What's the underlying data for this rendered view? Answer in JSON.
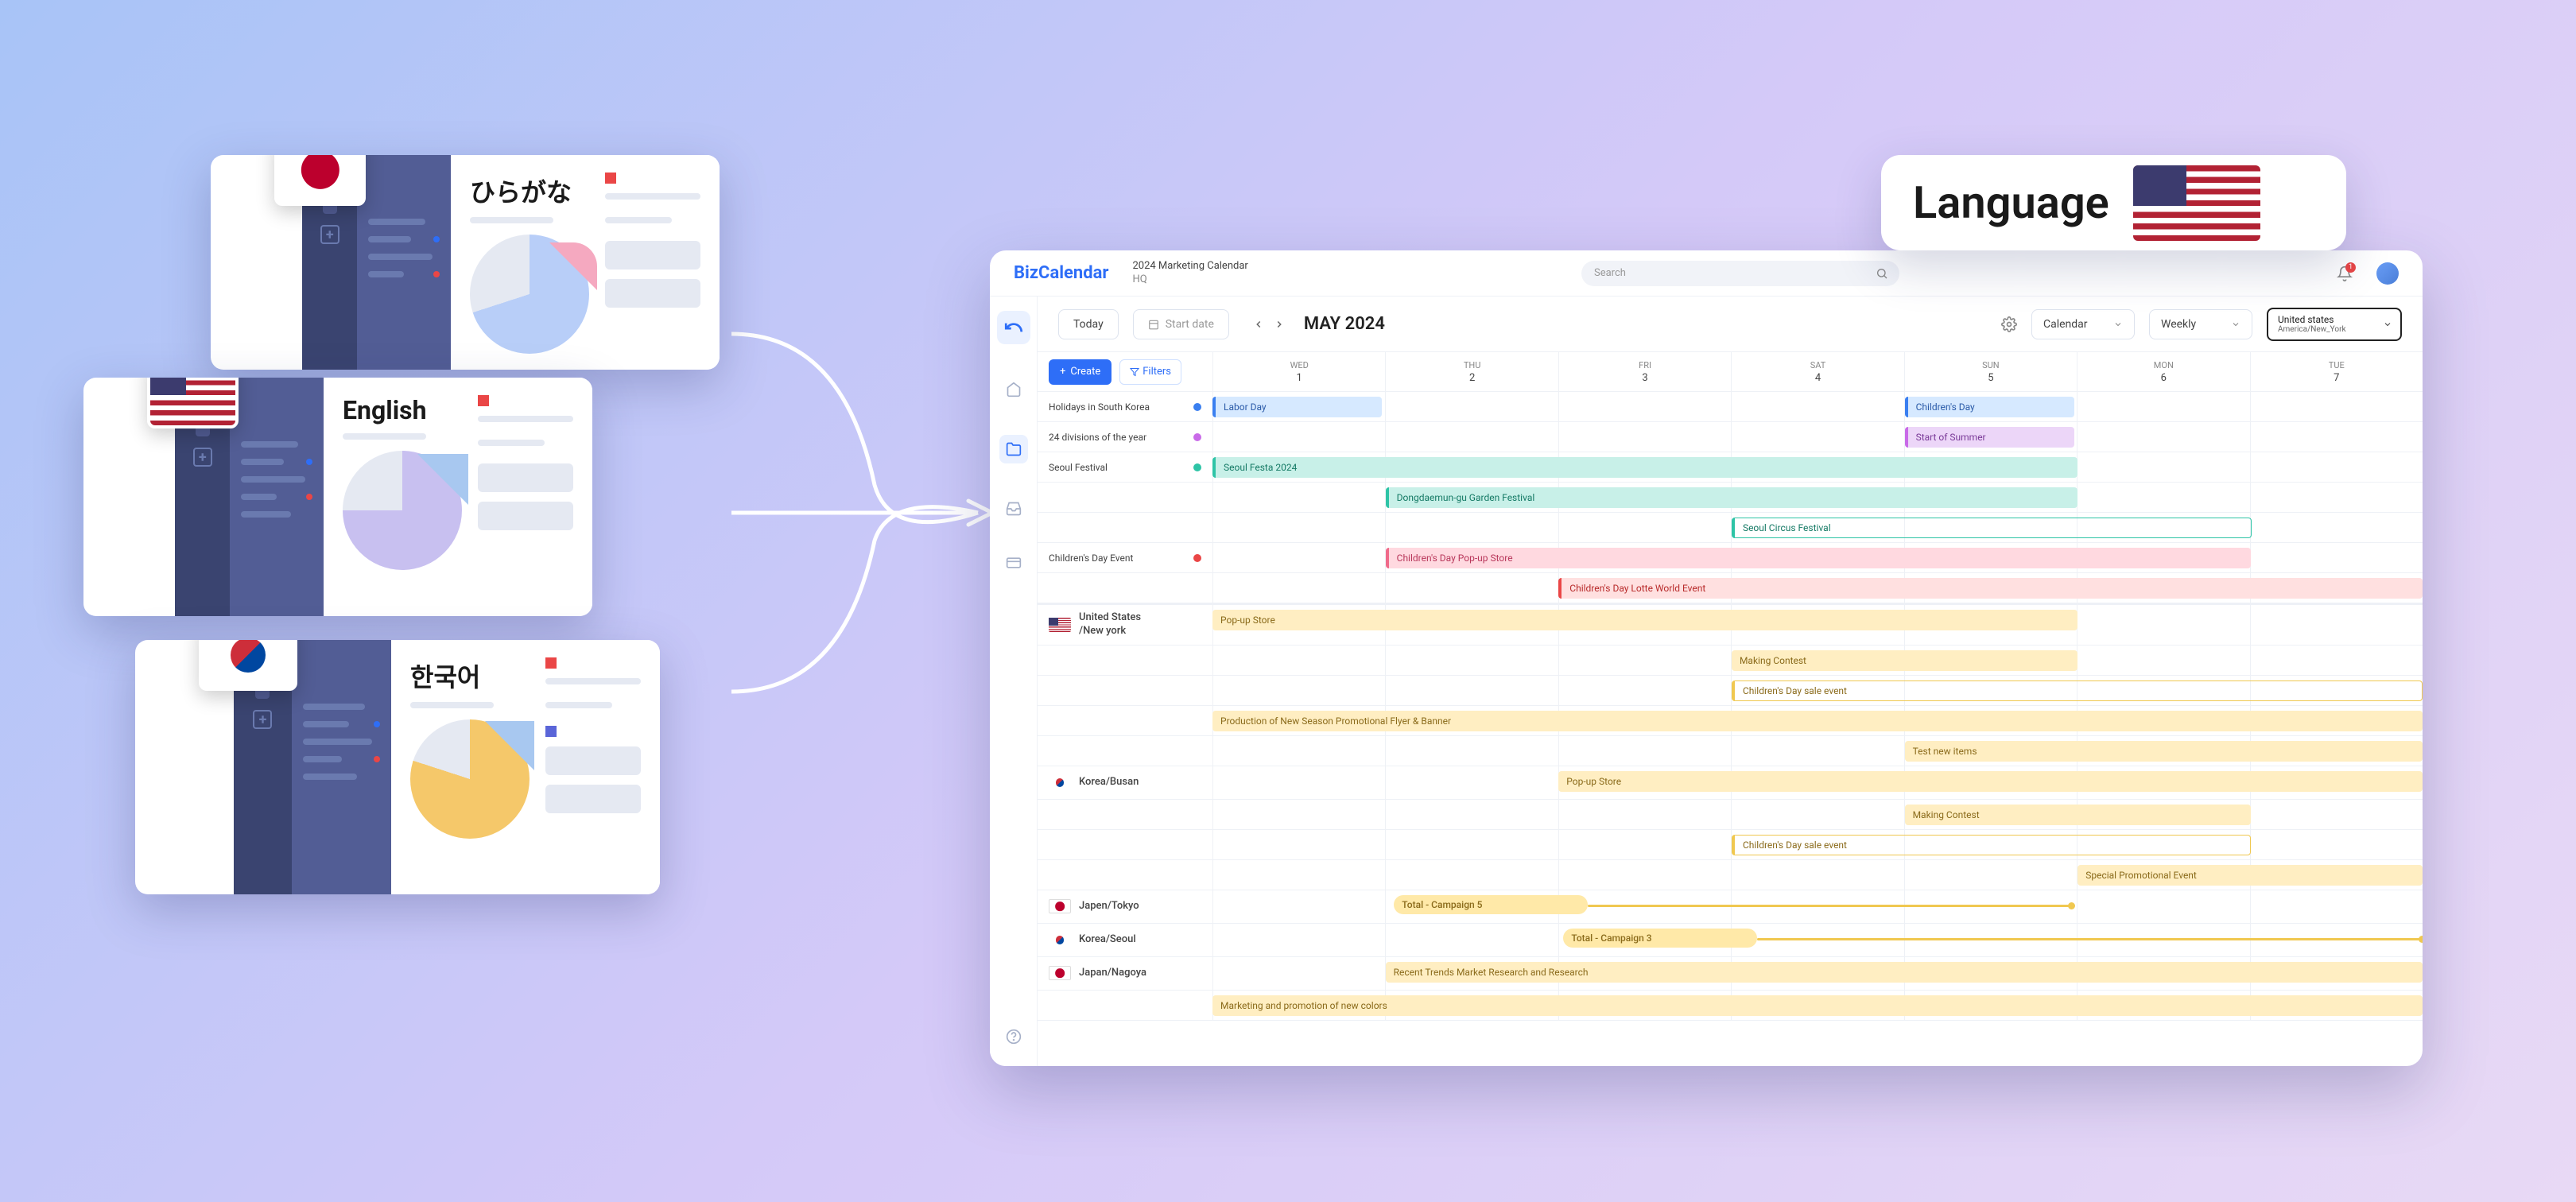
{
  "lang_badge": {
    "label": "Language"
  },
  "cards": {
    "jp": {
      "title": "ひらがな"
    },
    "en": {
      "title": "English"
    },
    "ko": {
      "title": "한국어"
    }
  },
  "app": {
    "brand": "BizCalendar",
    "title": "2024 Marketing Calendar",
    "subtitle": "HQ",
    "search_placeholder": "Search",
    "bell_count": "1",
    "toolbar": {
      "today": "Today",
      "start_date": "Start date",
      "month": "MAY 2024",
      "view_drop": "Calendar",
      "period_drop": "Weekly",
      "tz_label": "United states",
      "tz_sub": "America/New_York"
    },
    "buttons": {
      "create": "Create",
      "filters": "Filters"
    },
    "days": [
      {
        "dow": "WED",
        "num": "1"
      },
      {
        "dow": "THU",
        "num": "2"
      },
      {
        "dow": "FRI",
        "num": "3"
      },
      {
        "dow": "SAT",
        "num": "4"
      },
      {
        "dow": "SUN",
        "num": "5"
      },
      {
        "dow": "MON",
        "num": "6"
      },
      {
        "dow": "TUE",
        "num": "7"
      }
    ],
    "rows": {
      "holidays": "Holidays in South Korea",
      "divisions": "24 divisions of the year",
      "seoul_fest": "Seoul Festival",
      "childrens": "Children's Day Event"
    },
    "events": {
      "labor_day": "Labor Day",
      "childrens_day": "Children's Day",
      "start_summer": "Start of Summer",
      "seoul_festa": "Seoul Festa 2024",
      "dongdaemun": "Dongdaemun-gu Garden Festival",
      "circus": "Seoul Circus Festival",
      "popup_store": "Children's Day Pop-up Store",
      "lotte": "Children's Day Lotte World Event",
      "popup": "Pop-up Store",
      "making": "Making Contest",
      "sale_event": "Children's Day sale event",
      "promo_flyer": "Production of New Season Promotional Flyer & Banner",
      "test_items": "Test new items",
      "popup2": "Pop-up Store",
      "making2": "Making Contest",
      "sale_event2": "Children's Day sale event",
      "special_promo": "Special Promotional Event",
      "campaign5": "Total - Campaign 5",
      "campaign3": "Total - Campaign 3",
      "trends": "Recent Trends Market Research and Research",
      "marketing_colors": "Marketing and promotion of new colors"
    },
    "regions": {
      "us": "United States\n/New york",
      "kr_busan": "Korea/Busan",
      "jp_tokyo": "Japen/Tokyo",
      "kr_seoul": "Korea/Seoul",
      "jp_nagoya": "Japan/Nagoya"
    }
  }
}
